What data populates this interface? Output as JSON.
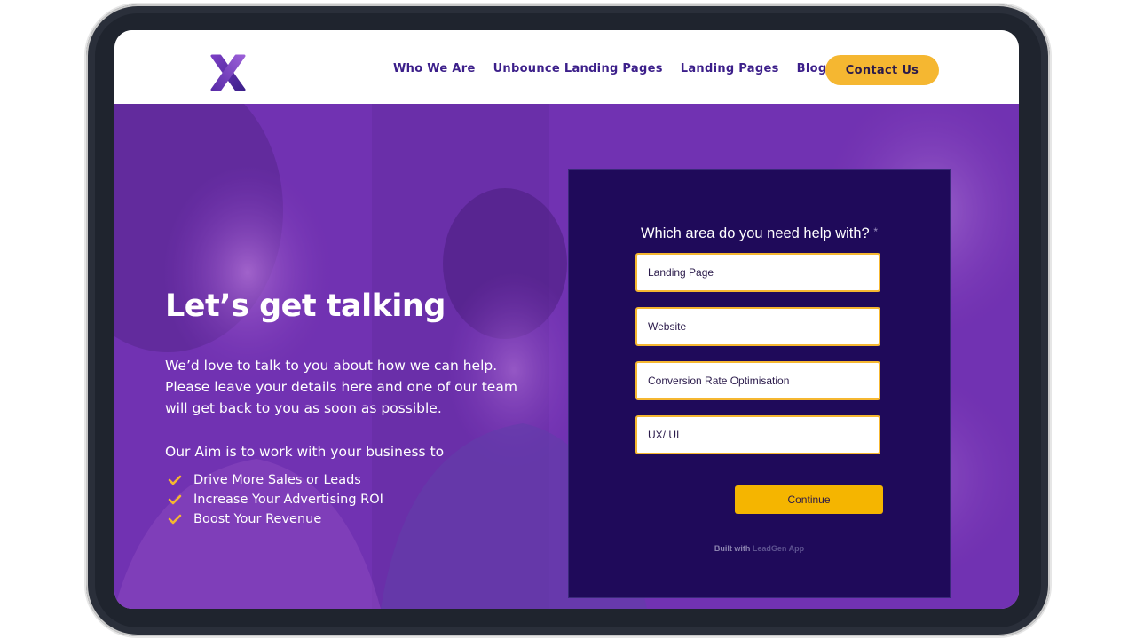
{
  "navbar": {
    "logo_icon": "x-logo-icon",
    "links": [
      "Who We Are",
      "Unbounce Landing Pages",
      "Landing Pages",
      "Blog"
    ],
    "contact_label": "Contact Us"
  },
  "hero": {
    "title": "Let’s get talking",
    "description": "We’d love to talk to you about how we can help. Please leave your details here and one of our team will get back to you as soon as possible.",
    "aim_text": "Our Aim is to work with your business to",
    "benefits": [
      "Drive More Sales or Leads",
      "Increase Your Advertising ROI",
      "Boost Your Revenue"
    ],
    "check_icon": "checkmark-icon"
  },
  "form": {
    "question": "Which area do you need help with?",
    "required_mark": "*",
    "options": [
      "Landing Page",
      "Website",
      "Conversion Rate Optimisation",
      "UX/ UI"
    ],
    "continue_label": "Continue",
    "built_with_prefix": "Built with",
    "built_with_brand": "LeadGen App"
  },
  "colors": {
    "brand_purple": "#3c1f8a",
    "accent_yellow": "#f5b731",
    "form_background": "#1f0a5a",
    "hero_overlay": "#7a36b8"
  }
}
